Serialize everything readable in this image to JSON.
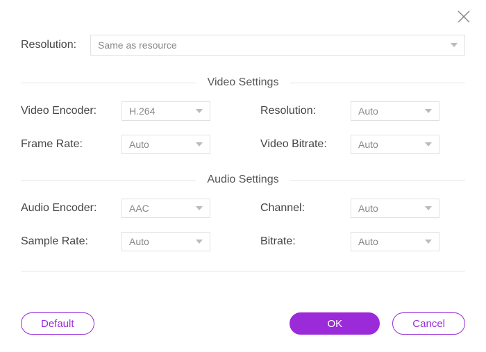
{
  "close_icon": "close",
  "top": {
    "label": "Resolution:",
    "value": "Same as resource"
  },
  "video_section_title": "Video Settings",
  "audio_section_title": "Audio Settings",
  "video": {
    "encoder_label": "Video Encoder:",
    "encoder_value": "H.264",
    "resolution_label": "Resolution:",
    "resolution_value": "Auto",
    "framerate_label": "Frame Rate:",
    "framerate_value": "Auto",
    "bitrate_label": "Video Bitrate:",
    "bitrate_value": "Auto"
  },
  "audio": {
    "encoder_label": "Audio Encoder:",
    "encoder_value": "AAC",
    "channel_label": "Channel:",
    "channel_value": "Auto",
    "samplerate_label": "Sample Rate:",
    "samplerate_value": "Auto",
    "bitrate_label": "Bitrate:",
    "bitrate_value": "Auto"
  },
  "buttons": {
    "default": "Default",
    "ok": "OK",
    "cancel": "Cancel"
  },
  "colors": {
    "accent": "#9b2bd8",
    "border": "#e0e0e0",
    "text": "#555"
  }
}
